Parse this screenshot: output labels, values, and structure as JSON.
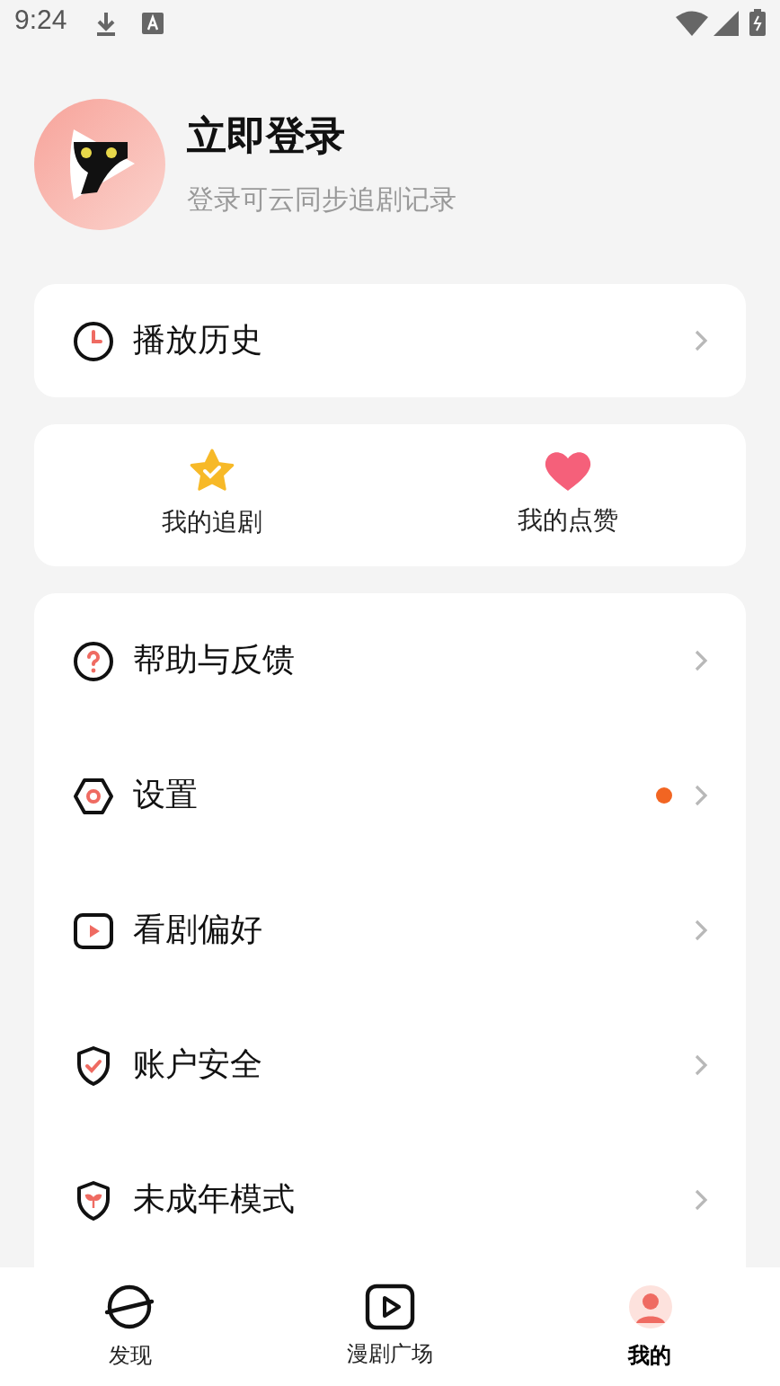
{
  "status_bar": {
    "time": "9:24"
  },
  "profile": {
    "title": "立即登录",
    "subtitle": "登录可云同步追剧记录"
  },
  "history": {
    "label": "播放历史"
  },
  "shortcuts": [
    {
      "label": "我的追剧"
    },
    {
      "label": "我的点赞"
    }
  ],
  "menu": [
    {
      "label": "帮助与反馈",
      "dot": false
    },
    {
      "label": "设置",
      "dot": true
    },
    {
      "label": "看剧偏好",
      "dot": false
    },
    {
      "label": "账户安全",
      "dot": false
    },
    {
      "label": "未成年模式",
      "dot": false
    }
  ],
  "tabs": [
    {
      "label": "发现",
      "selected": false
    },
    {
      "label": "漫剧广场",
      "selected": false
    },
    {
      "label": "我的",
      "selected": true
    }
  ]
}
